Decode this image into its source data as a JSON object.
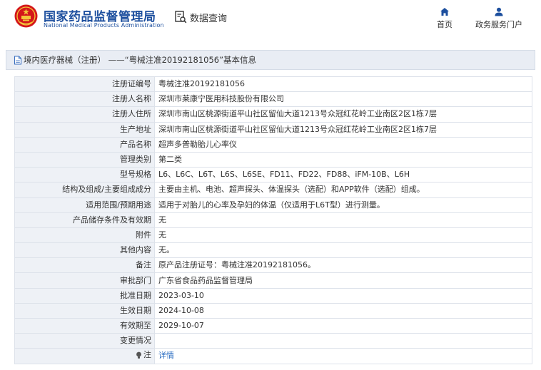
{
  "header": {
    "brand_cn": "国家药品监督管理局",
    "brand_en": "National Medical Products Administration",
    "search_label": "数据查询",
    "nav": [
      {
        "label": "首页",
        "icon": "home-icon"
      },
      {
        "label": "政务服务门户",
        "icon": "user-icon"
      }
    ],
    "brand_color": "#1d4f9e",
    "emblem_color": "#d4161a"
  },
  "breadcrumb": {
    "text": "境内医疗器械（注册） ——“粤械注准20192181056”基本信息",
    "icon": "document-icon"
  },
  "rows": [
    {
      "key": "注册证编号",
      "value": "粤械注准20192181056"
    },
    {
      "key": "注册人名称",
      "value": "深圳市莱康宁医用科技股份有限公司"
    },
    {
      "key": "注册人住所",
      "value": "深圳市南山区桃源街道平山社区留仙大道1213号众冠红花岭工业南区2区1栋7层"
    },
    {
      "key": "生产地址",
      "value": "深圳市南山区桃源街道平山社区留仙大道1213号众冠红花岭工业南区2区1栋7层"
    },
    {
      "key": "产品名称",
      "value": "超声多普勒胎儿心率仪"
    },
    {
      "key": "管理类别",
      "value": "第二类"
    },
    {
      "key": "型号规格",
      "value": "L6、L6C、L6T、L6S、L6SE、FD11、FD22、FD88、iFM-10B、L6H"
    },
    {
      "key": "结构及组成/主要组成成分",
      "value": "主要由主机、电池、超声探头、体温探头（选配）和APP软件（选配）组成。"
    },
    {
      "key": "适用范围/预期用途",
      "value": "适用于对胎儿的心率及孕妇的体温（仅适用于L6T型）进行测量。"
    },
    {
      "key": "产品储存条件及有效期",
      "value": "无"
    },
    {
      "key": "附件",
      "value": "无"
    },
    {
      "key": "其他内容",
      "value": "无。"
    },
    {
      "key": "备注",
      "value": "原产品注册证号：粤械注准20192181056。"
    },
    {
      "key": "审批部门",
      "value": "广东省食品药品监督管理局"
    },
    {
      "key": "批准日期",
      "value": "2023-03-10"
    },
    {
      "key": "生效日期",
      "value": "2024-10-08"
    },
    {
      "key": "有效期至",
      "value": "2029-10-07"
    },
    {
      "key": "变更情况",
      "value": ""
    }
  ],
  "note_row": {
    "key": "注",
    "value": "详情",
    "icon": "lightbulb-icon",
    "link_color": "#2a6cc2"
  }
}
